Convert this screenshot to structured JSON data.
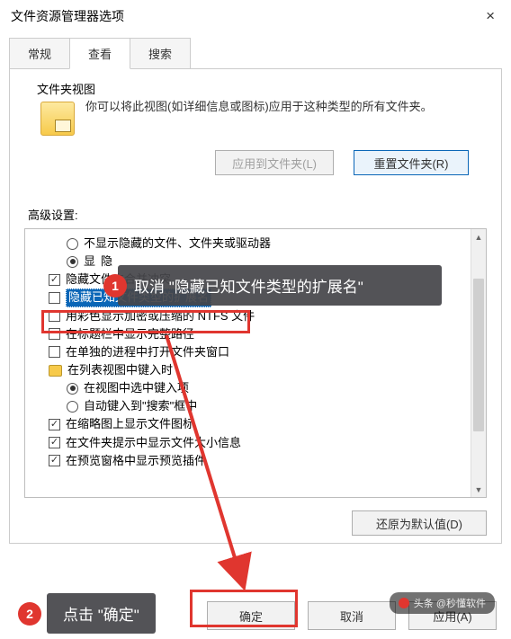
{
  "window": {
    "title": "文件资源管理器选项",
    "close": "×"
  },
  "tabs": {
    "general": "常规",
    "view": "查看",
    "search": "搜索"
  },
  "folderViews": {
    "group_label": "文件夹视图",
    "description": "你可以将此视图(如详细信息或图标)应用于这种类型的所有文件夹。",
    "apply_btn": "应用到文件夹(L)",
    "reset_btn": "重置文件夹(R)"
  },
  "advanced": {
    "label": "高级设置:",
    "items": {
      "r0": "不显示隐藏的文件、文件夹或驱动器",
      "r1_prefix": "显",
      "r1_rest": "隐",
      "r2": "隐藏文件夹合并冲突",
      "r3": "隐藏已知文件类型的扩展名",
      "r4": "用彩色显示加密或压缩的 NTFS 文件",
      "r5": "在标题栏中显示完整路径",
      "r6": "在单独的进程中打开文件夹窗口",
      "r7": "在列表视图中键入时",
      "r8": "在视图中选中键入项",
      "r9": "自动键入到\"搜索\"框中",
      "r10": "在缩略图上显示文件图标",
      "r11": "在文件夹提示中显示文件大小信息",
      "r12": "在预览窗格中显示预览插件"
    }
  },
  "restore_defaults": "还原为默认值(D)",
  "bottom": {
    "ok": "确定",
    "cancel": "取消",
    "apply": "应用(A)"
  },
  "annotations": {
    "step1": "取消 \"隐藏已知文件类型的扩展名\"",
    "step2": "点击 \"确定\"",
    "num1": "1",
    "num2": "2"
  },
  "watermark": "头条 @秒懂软件"
}
